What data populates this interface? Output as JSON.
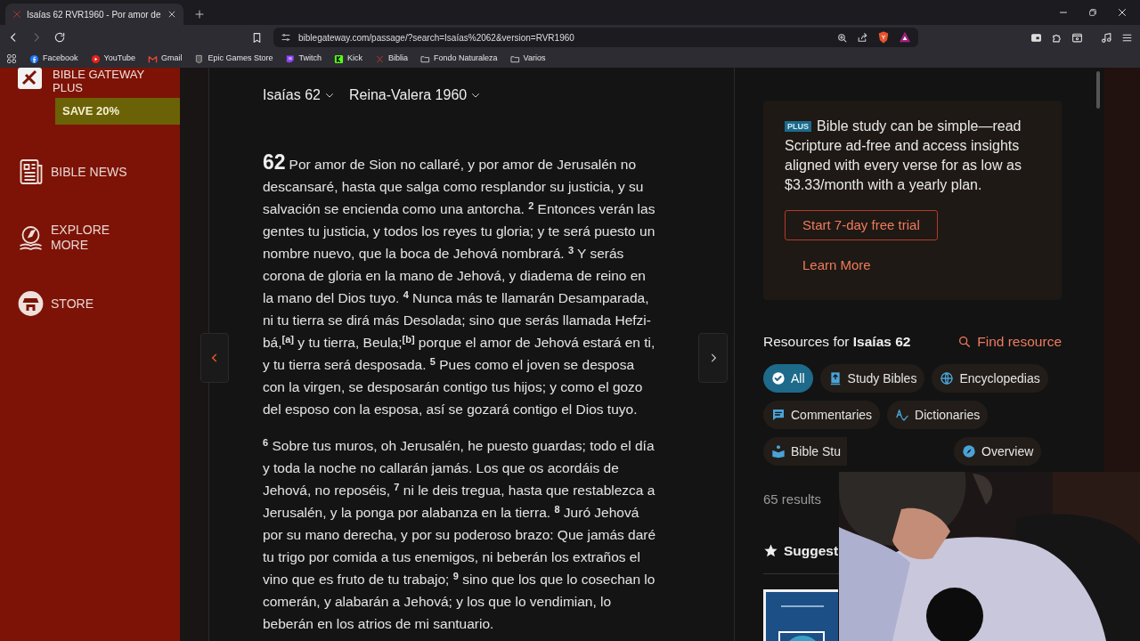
{
  "browser": {
    "tab": {
      "title": "Isaías 62 RVR1960 - Por amor de"
    },
    "url": "biblegateway.com/passage/?search=Isaías%2062&version=RVR1960",
    "back_enabled": true,
    "forward_enabled": false,
    "bookmarks": [
      "Facebook",
      "YouTube",
      "Gmail",
      "Epic Games Store",
      "Twitch",
      "Kick",
      "Biblia",
      "Fondo Naturaleza",
      "Varios"
    ]
  },
  "sidebar": {
    "brand": [
      "BIBLE GATEWAY",
      "PLUS"
    ],
    "promo": "SAVE 20%",
    "items": [
      {
        "label": "BIBLE NEWS"
      },
      {
        "label": "EXPLORE MORE"
      },
      {
        "label": "STORE"
      }
    ]
  },
  "passage": {
    "book_selector": "Isaías 62",
    "version_selector": "Reina-Valera 1960",
    "chapter_number": "62",
    "paragraphs": [
      "Por amor de Sion no callaré, y por amor de Jerusalén no descansaré, hasta que salga como resplandor su justicia, y su salvación se encienda como una antorcha. $^{2}$ Entonces verán las gentes tu justicia, y todos los reyes tu gloria; y te será puesto un nombre nuevo, que la boca de Jehová nombrará. $^{3}$ Y serás corona de gloria en la mano de Jehová, y diadema de reino en la mano del Dios tuyo. $^{4}$ Nunca más te llamarán Desamparada, ni tu tierra se dirá más Desolada; sino que serás llamada Hefzi-bá,$^{[a]}$ y tu tierra, Beula;$^{[b]}$ porque el amor de Jehová estará en ti, y tu tierra será desposada. $^{5}$ Pues como el joven se desposa con la virgen, se desposarán contigo tus hijos; y como el gozo del esposo con la esposa, así se gozará contigo el Dios tuyo.",
      "$^{6}$ Sobre tus muros, oh Jerusalén, he puesto guardas; todo el día y toda la noche no callarán jamás. Los que os acordáis de Jehová, no reposéis, $^{7}$ ni le deis tregua, hasta que restablezca a Jerusalén, y la ponga por alabanza en la tierra. $^{8}$ Juró Jehová por su mano derecha, y por su poderoso brazo: Que jamás daré tu trigo por comida a tus enemigos, ni beberán los extraños el vino que es fruto de tu trabajo; $^{9}$ sino que los que lo cosechan lo comerán, y alabarán a Jehová; y los que lo vendimian, lo beberán en los atrios de mi santuario."
    ]
  },
  "promo_card": {
    "badge": "PLUS",
    "text": "Bible study can be simple—read Scripture ad-free and access insights aligned with every verse for as low as $3.33/month with a yearly plan.",
    "button": "Start 7-day free trial",
    "link": "Learn More"
  },
  "resources": {
    "title": "Resources for **Isaías 62**",
    "find": "Find resource",
    "filters": [
      {
        "label": "All",
        "selected": true
      },
      {
        "label": "Study Bibles",
        "selected": false
      },
      {
        "label": "Encyclopedias",
        "selected": false
      },
      {
        "label": "Commentaries",
        "selected": false
      },
      {
        "label": "Dictionaries",
        "selected": false
      },
      {
        "label": "Bible Stu",
        "selected": false
      },
      {
        "label": "Overview",
        "selected": false
      }
    ],
    "results": "65 results",
    "suggested": "Suggest"
  }
}
